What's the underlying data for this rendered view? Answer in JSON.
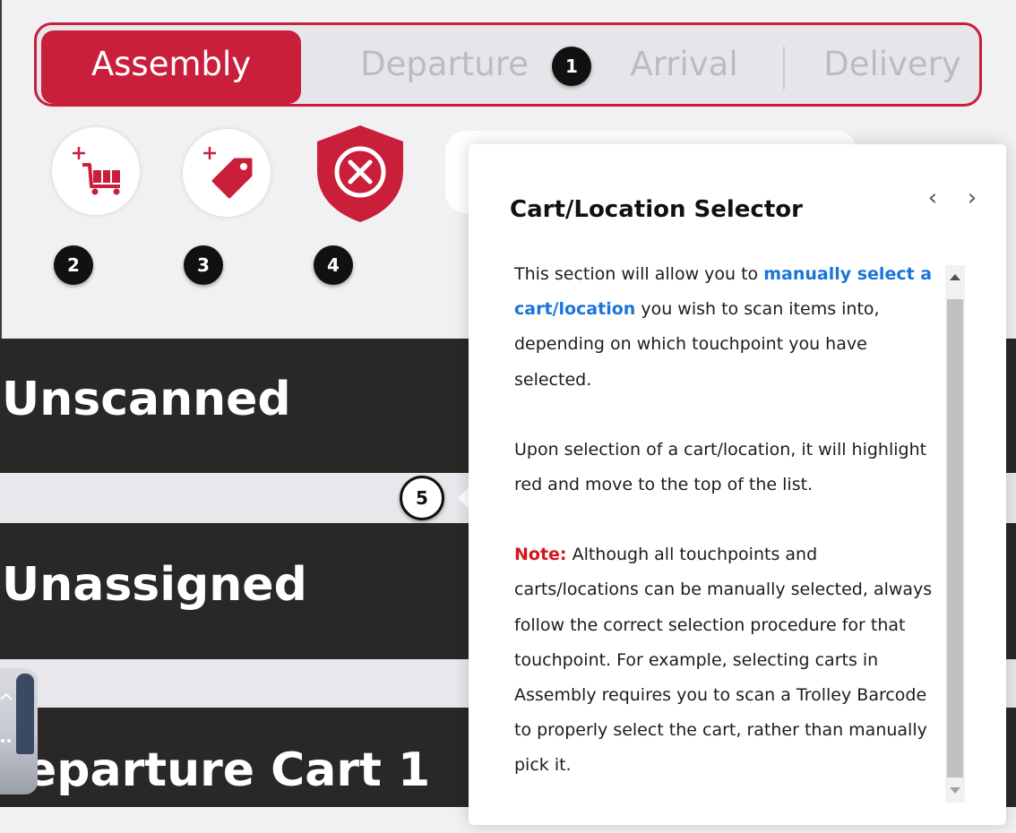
{
  "tabs": [
    {
      "label": "Assembly",
      "active": true
    },
    {
      "label": "Departure",
      "active": false
    },
    {
      "label": "Arrival",
      "active": false
    },
    {
      "label": "Delivery",
      "active": false
    }
  ],
  "markers": [
    "1",
    "2",
    "3",
    "4",
    "5"
  ],
  "actions": {
    "add_cart_icon": "add-cart-icon",
    "add_tag_icon": "add-tag-icon",
    "cancel_icon": "shield-cancel-icon"
  },
  "lists": {
    "unscanned": "Unscanned",
    "unassigned": "Unassigned",
    "departure_cart": "eparture Cart 1"
  },
  "popover": {
    "title": "Cart/Location Selector",
    "p1_before": "This section will allow you to ",
    "p1_highlight": "manually select a cart/location",
    "p1_after": " you wish to scan items into, depending on which touchpoint you have selected.",
    "p2": "Upon selection of a cart/location, it will highlight red and move to the top of the list.",
    "note_label": "Note:",
    "note_text": " Although all touchpoints and carts/locations can be manually selected, always follow the correct selection procedure for that touchpoint. For example, selecting carts in Assembly requires you to scan a Trolley Barcode to properly select the cart, rather than manually pick it.",
    "prev_glyph": "‹",
    "next_glyph": "›"
  },
  "colors": {
    "brand_red": "#c91f3a",
    "link_blue": "#1a75d8",
    "note_red": "#d4151d",
    "list_dark": "#2a2727"
  }
}
